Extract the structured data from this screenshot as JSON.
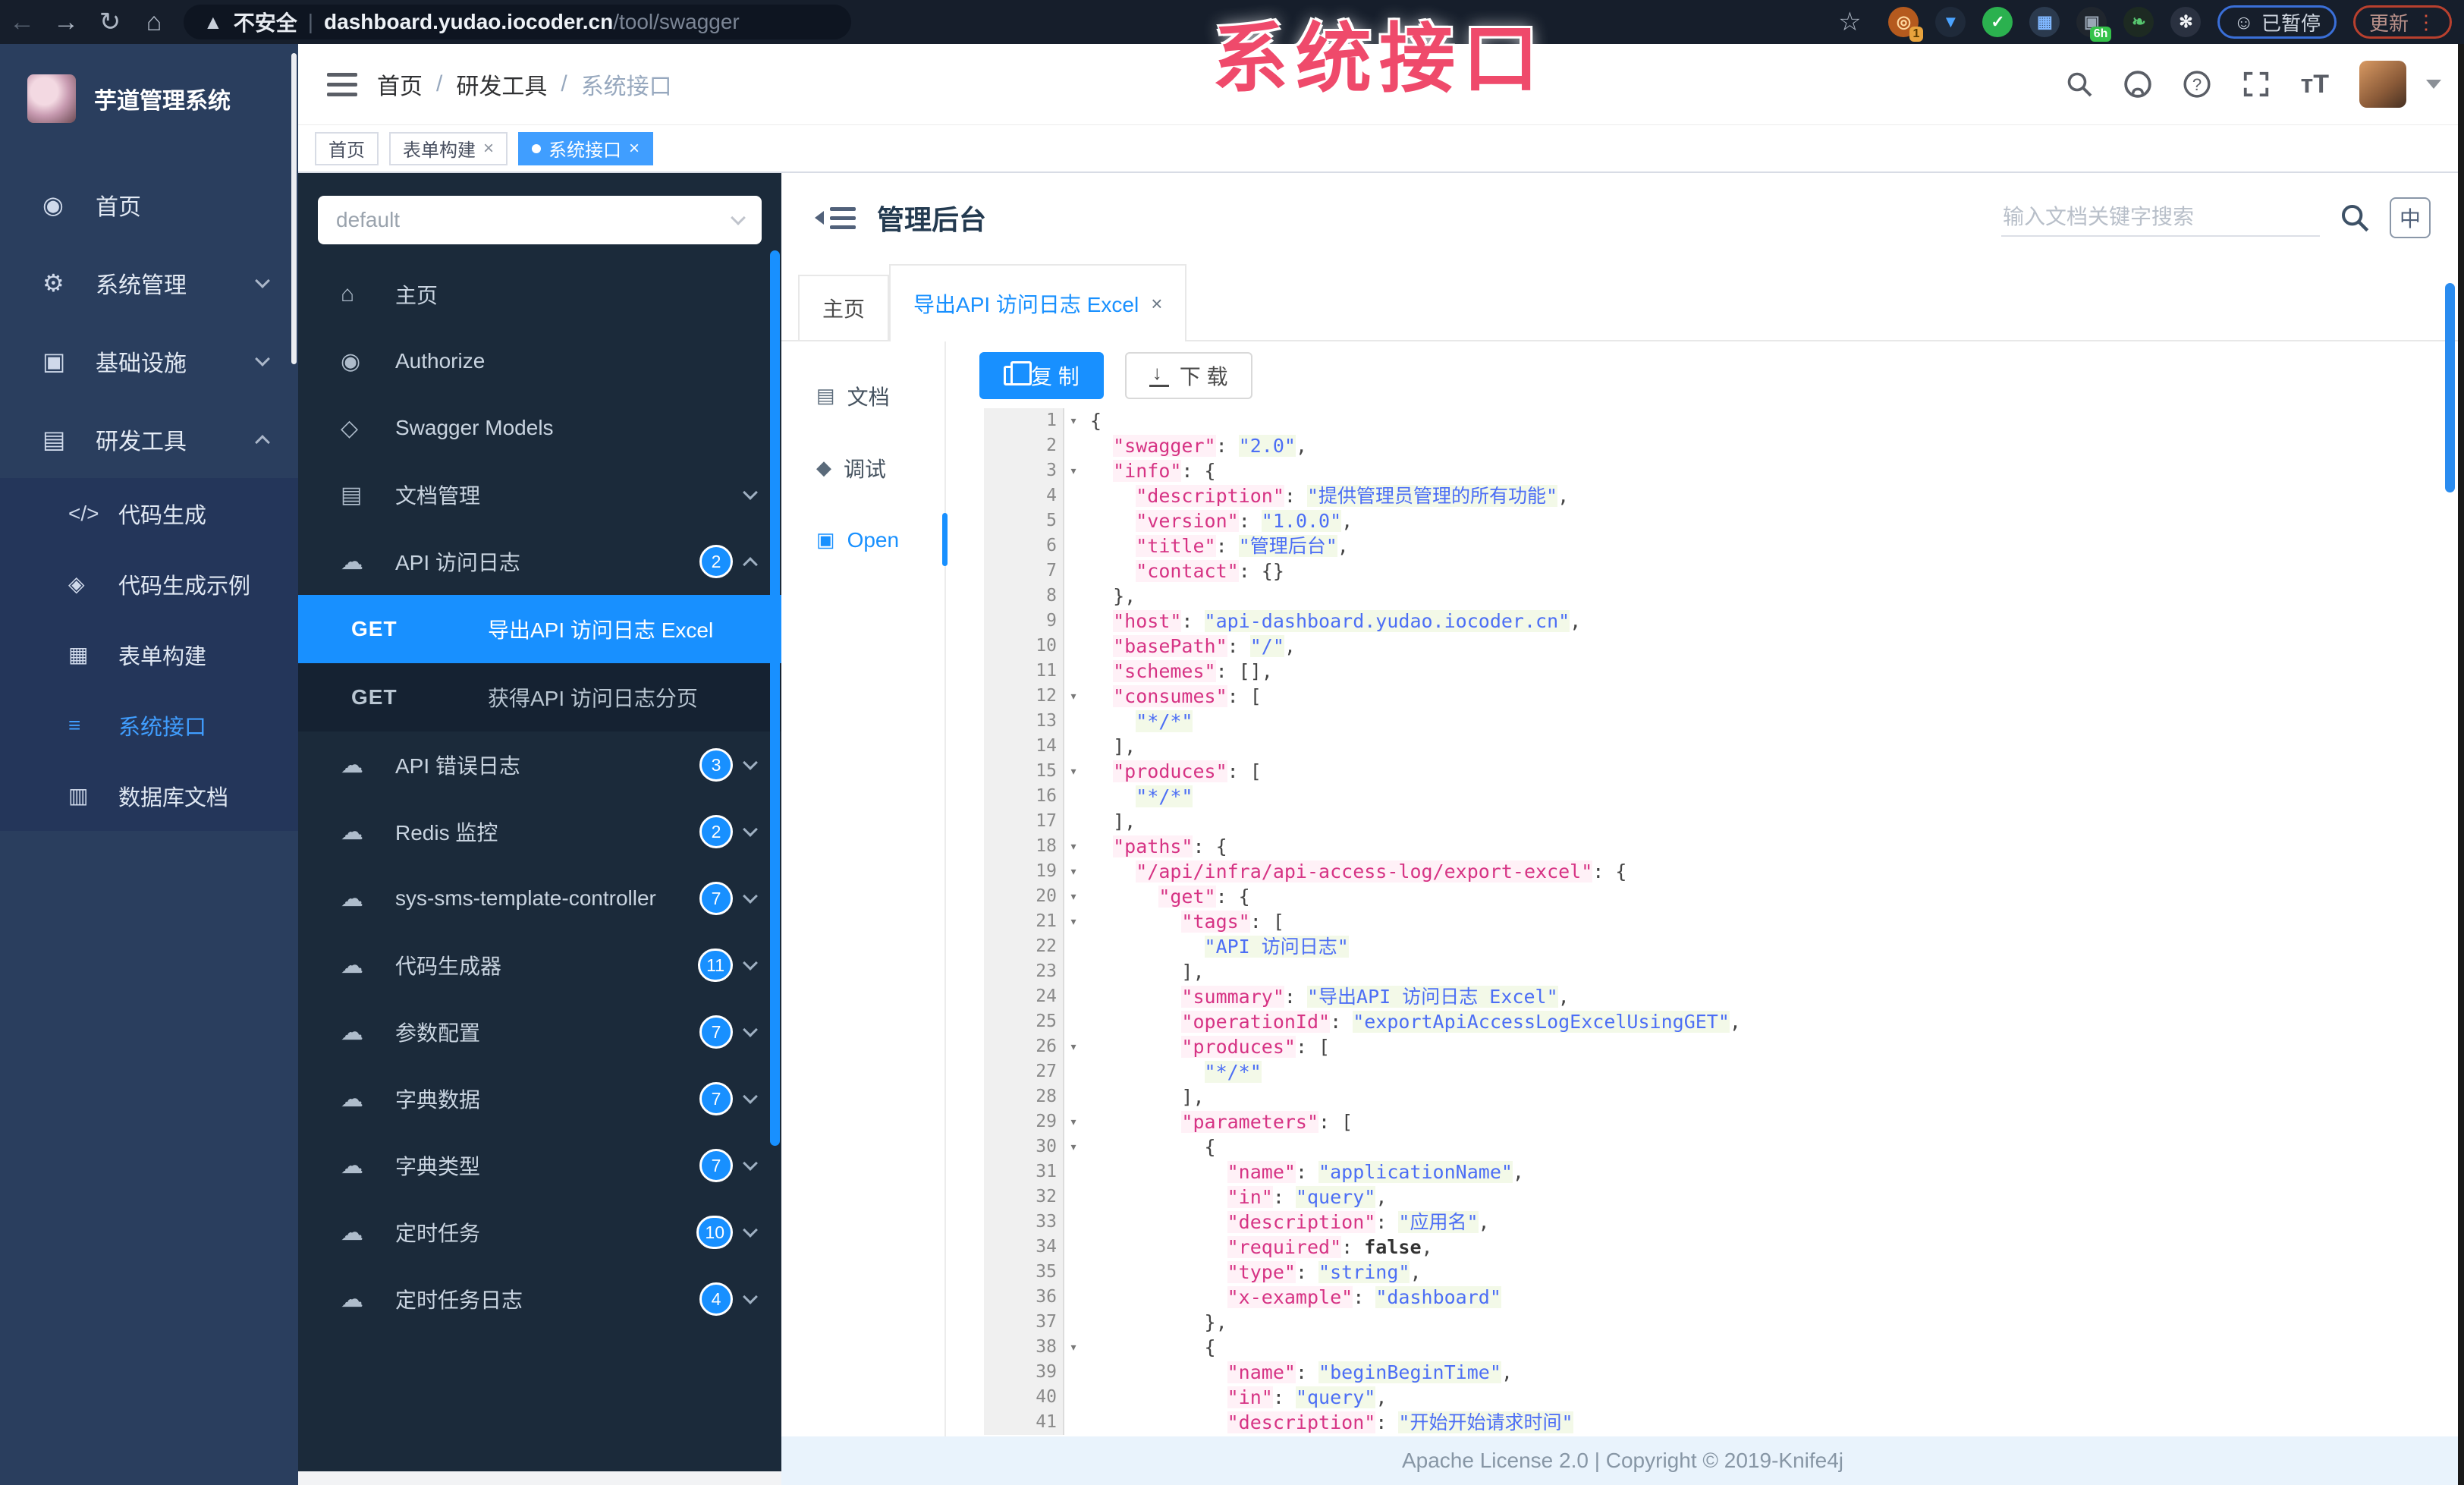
{
  "watermark": "系统接口",
  "browser": {
    "security_label": "不安全",
    "url_host": "dashboard.yudao.iocoder.cn",
    "url_path": "/tool/swagger",
    "orange_badge": "1",
    "camera_badge": "6h",
    "paused_label": "已暂停",
    "update_label": "更新"
  },
  "sidebar": {
    "title": "芋道管理系统",
    "items": [
      {
        "icon": "dashboard-icon",
        "glyph": "◉",
        "label": "首页",
        "chevron": null
      },
      {
        "icon": "gear-icon",
        "glyph": "⚙",
        "label": "系统管理",
        "chevron": "down"
      },
      {
        "icon": "infrastructure-icon",
        "glyph": "▣",
        "label": "基础设施",
        "chevron": "down"
      },
      {
        "icon": "tools-icon",
        "glyph": "▤",
        "label": "研发工具",
        "chevron": "up"
      }
    ],
    "sub_items": [
      {
        "icon": "code-icon",
        "glyph": "</>",
        "label": "代码生成",
        "active": false
      },
      {
        "icon": "shield-icon",
        "glyph": "◈",
        "label": "代码生成示例",
        "active": false
      },
      {
        "icon": "form-icon",
        "glyph": "▦",
        "label": "表单构建",
        "active": false
      },
      {
        "icon": "list-icon",
        "glyph": "≡",
        "label": "系统接口",
        "active": true
      },
      {
        "icon": "table-icon",
        "glyph": "▥",
        "label": "数据库文档",
        "active": false
      }
    ]
  },
  "navbar": {
    "breadcrumb": [
      "首页",
      "研发工具",
      "系统接口"
    ]
  },
  "tags": [
    {
      "label": "首页",
      "closable": false,
      "active": false
    },
    {
      "label": "表单构建",
      "closable": true,
      "active": false
    },
    {
      "label": "系统接口",
      "closable": true,
      "active": true
    }
  ],
  "swagger": {
    "group_value": "default",
    "items": [
      {
        "icon": "home-icon",
        "glyph": "⌂",
        "label": "主页",
        "badge": "",
        "chevron": null
      },
      {
        "icon": "authorize-icon",
        "glyph": "◉",
        "label": "Authorize",
        "badge": "",
        "chevron": null
      },
      {
        "icon": "models-icon",
        "glyph": "◇",
        "label": "Swagger Models",
        "badge": "",
        "chevron": null
      },
      {
        "icon": "doc-manage-icon",
        "glyph": "▤",
        "label": "文档管理",
        "badge": "",
        "chevron": "down"
      },
      {
        "icon": "cloud-icon",
        "glyph": "☁",
        "label": "API 访问日志",
        "badge": "2",
        "chevron": "up",
        "children": [
          {
            "method": "GET",
            "label": "导出API 访问日志 Excel",
            "selected": true
          },
          {
            "method": "GET",
            "label": "获得API 访问日志分页",
            "selected": false
          }
        ]
      },
      {
        "icon": "cloud-icon",
        "glyph": "☁",
        "label": "API 错误日志",
        "badge": "3",
        "chevron": "down"
      },
      {
        "icon": "cloud-icon",
        "glyph": "☁",
        "label": "Redis 监控",
        "badge": "2",
        "chevron": "down"
      },
      {
        "icon": "cloud-icon",
        "glyph": "☁",
        "label": "sys-sms-template-controller",
        "badge": "7",
        "chevron": "down"
      },
      {
        "icon": "cloud-icon",
        "glyph": "☁",
        "label": "代码生成器",
        "badge": "11",
        "chevron": "down"
      },
      {
        "icon": "cloud-icon",
        "glyph": "☁",
        "label": "参数配置",
        "badge": "7",
        "chevron": "down"
      },
      {
        "icon": "cloud-icon",
        "glyph": "☁",
        "label": "字典数据",
        "badge": "7",
        "chevron": "down"
      },
      {
        "icon": "cloud-icon",
        "glyph": "☁",
        "label": "字典类型",
        "badge": "7",
        "chevron": "down"
      },
      {
        "icon": "cloud-icon",
        "glyph": "☁",
        "label": "定时任务",
        "badge": "10",
        "chevron": "down"
      },
      {
        "icon": "cloud-icon",
        "glyph": "☁",
        "label": "定时任务日志",
        "badge": "4",
        "chevron": "down"
      }
    ]
  },
  "doc": {
    "title": "管理后台",
    "search_placeholder": "输入文档关键字搜索",
    "lang_button": "中",
    "tabs": [
      {
        "label": "主页",
        "closable": false,
        "active": false
      },
      {
        "label": "导出API 访问日志 Excel",
        "closable": true,
        "active": true
      }
    ],
    "side_items": [
      {
        "icon": "document-icon",
        "glyph": "▤",
        "label": "文档",
        "active": false
      },
      {
        "icon": "debug-icon",
        "glyph": "◆",
        "label": "调试",
        "active": false
      },
      {
        "icon": "open-icon",
        "glyph": "▣",
        "label": "Open",
        "active": true
      }
    ],
    "copy_label": "复 制",
    "download_label": "下 载"
  },
  "code": {
    "folds": [
      1,
      3,
      12,
      15,
      18,
      19,
      20,
      21,
      26,
      29,
      30,
      38
    ],
    "lines": [
      "{",
      "  \"swagger\": \"2.0\",",
      "  \"info\": {",
      "    \"description\": \"提供管理员管理的所有功能\",",
      "    \"version\": \"1.0.0\",",
      "    \"title\": \"管理后台\",",
      "    \"contact\": {}",
      "  },",
      "  \"host\": \"api-dashboard.yudao.iocoder.cn\",",
      "  \"basePath\": \"/\",",
      "  \"schemes\": [],",
      "  \"consumes\": [",
      "    \"*/*\"",
      "  ],",
      "  \"produces\": [",
      "    \"*/*\"",
      "  ],",
      "  \"paths\": {",
      "    \"/api/infra/api-access-log/export-excel\": {",
      "      \"get\": {",
      "        \"tags\": [",
      "          \"API 访问日志\"",
      "        ],",
      "        \"summary\": \"导出API 访问日志 Excel\",",
      "        \"operationId\": \"exportApiAccessLogExcelUsingGET\",",
      "        \"produces\": [",
      "          \"*/*\"",
      "        ],",
      "        \"parameters\": [",
      "          {",
      "            \"name\": \"applicationName\",",
      "            \"in\": \"query\",",
      "            \"description\": \"应用名\",",
      "            \"required\": false,",
      "            \"type\": \"string\",",
      "            \"x-example\": \"dashboard\"",
      "          },",
      "          {",
      "            \"name\": \"beginBeginTime\",",
      "            \"in\": \"query\",",
      "            \"description\": \"开始开始请求时间\""
    ]
  },
  "footer": {
    "text": "Apache License 2.0 | Copyright © 2019-Knife4j"
  }
}
